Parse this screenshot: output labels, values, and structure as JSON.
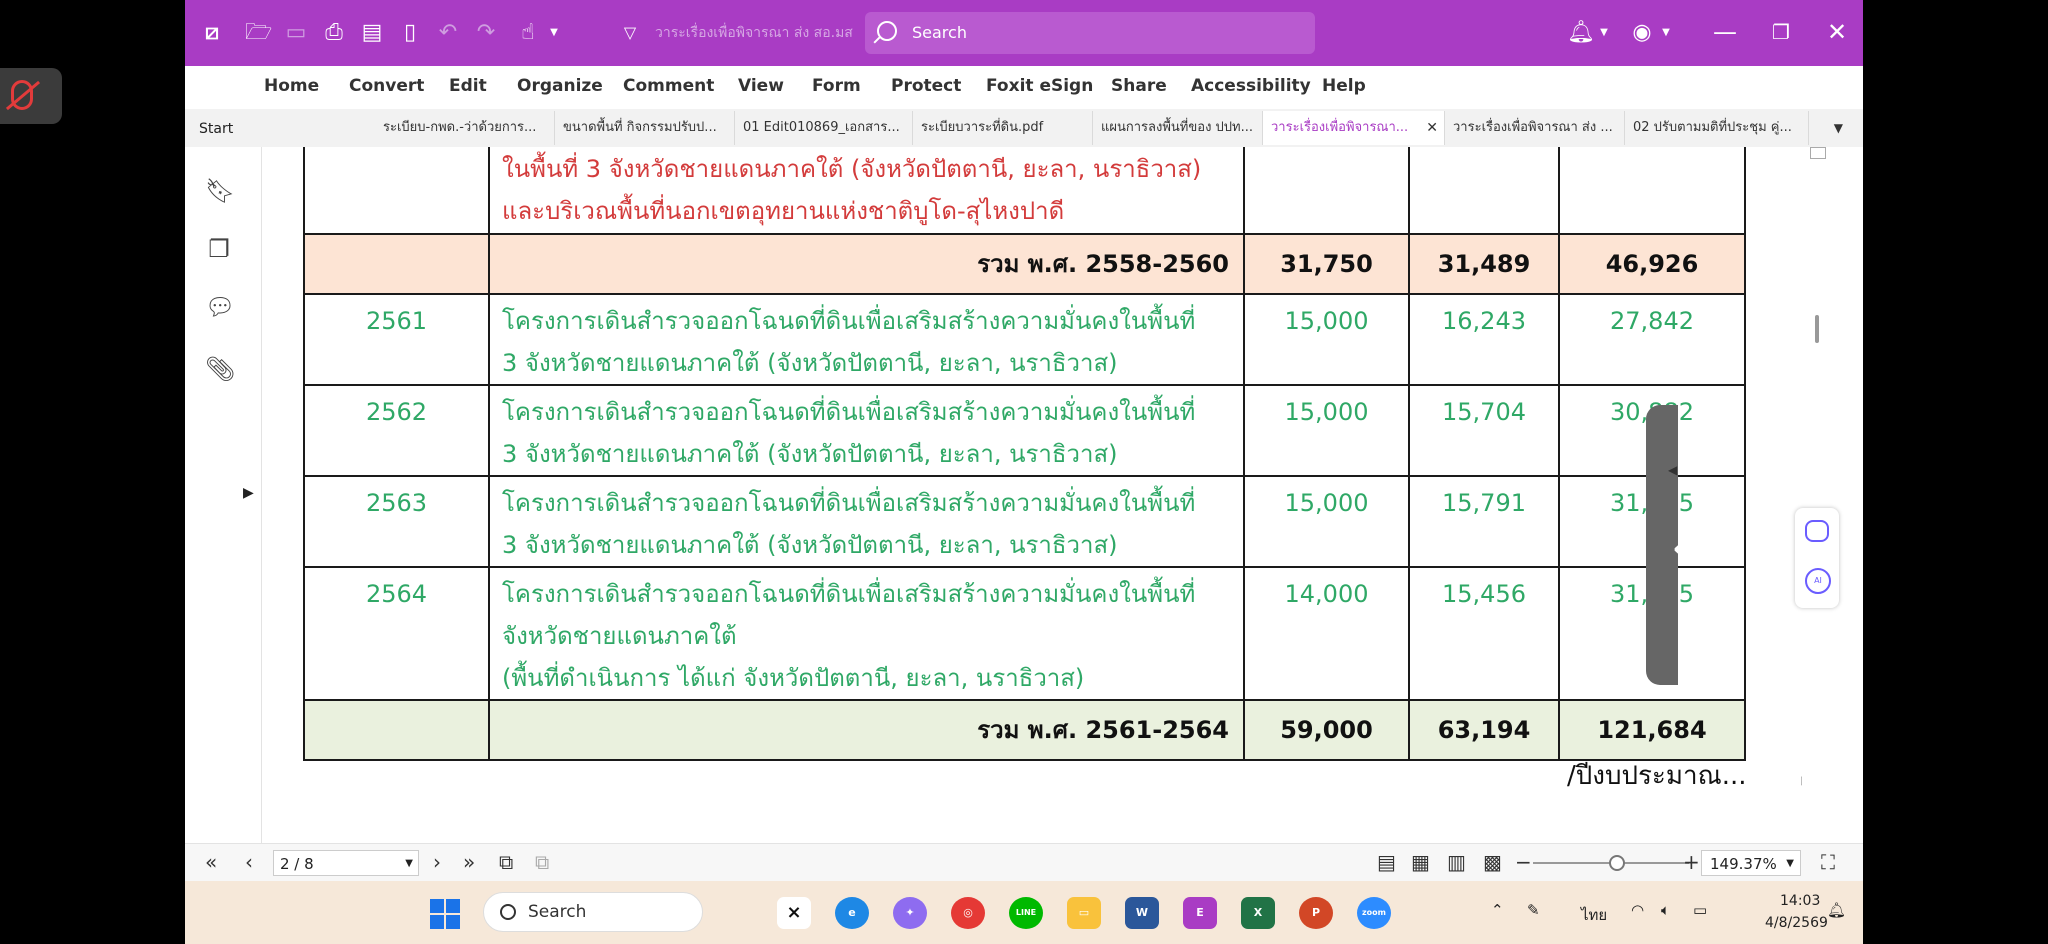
{
  "titlebar": {
    "doc_title": "วาระเรื่องเพื่อพิจารณา ส่ง สอ.มส",
    "search_placeholder": "Search"
  },
  "menu": [
    "Home",
    "Convert",
    "Edit",
    "Organize",
    "Comment",
    "View",
    "Form",
    "Protect",
    "Foxit eSign",
    "Share",
    "Accessibility",
    "Help"
  ],
  "tabs": {
    "start": "Start",
    "items": [
      "ระเบียบ-กพด.-ว่าด้วยการ...",
      "ขนาดพื้นที่ กิจกรรมปรับป...",
      "01 Edit010869_เอกสาร...",
      "ระเบียบวาระที่ดิน.pdf",
      "แผนการลงพื้นที่ของ ปปท...",
      "วาระเรื่องเพื่อพิจารณา...",
      "วาระเรื่องเพื่อพิจารณา ส่ง ...",
      "02 ปรับตามมติที่ประชุม คู่..."
    ],
    "close_glyph": "✕"
  },
  "table": {
    "top_row": {
      "line1": "ในพื้นที่ 3 จังหวัดชายแดนภาคใต้ (จังหวัดปัตตานี, ยะลา, นราธิวาส)",
      "line2": "และบริเวณพื้นที่นอกเขตอุทยานแห่งชาติบูโด-สุไหงปาดี"
    },
    "sum1": {
      "label": "รวม พ.ศ. 2558-2560",
      "v1": "31,750",
      "v2": "31,489",
      "v3": "46,926"
    },
    "rows": [
      {
        "year": "2561",
        "line1": "โครงการเดินสำรวจออกโฉนดที่ดินเพื่อเสริมสร้างความมั่นคงในพื้นที่",
        "line2": "3 จังหวัดชายแดนภาคใต้ (จังหวัดปัตตานี, ยะลา, นราธิวาส)",
        "line3": "",
        "v1": "15,000",
        "v2": "16,243",
        "v3": "27,842"
      },
      {
        "year": "2562",
        "line1": "โครงการเดินสำรวจออกโฉนดที่ดินเพื่อเสริมสร้างความมั่นคงในพื้นที่",
        "line2": "3 จังหวัดชายแดนภาคใต้ (จังหวัดปัตตานี, ยะลา, นราธิวาส)",
        "line3": "",
        "v1": "15,000",
        "v2": "15,704",
        "v3": "30,882"
      },
      {
        "year": "2563",
        "line1": "โครงการเดินสำรวจออกโฉนดที่ดินเพื่อเสริมสร้างความมั่นคงในพื้นที่",
        "line2": "3 จังหวัดชายแดนภาคใต้ (จังหวัดปัตตานี, ยะลา, นราธิวาส)",
        "line3": "",
        "v1": "15,000",
        "v2": "15,791",
        "v3": "31,575"
      },
      {
        "year": "2564",
        "line1": "โครงการเดินสำรวจออกโฉนดที่ดินเพื่อเสริมสร้างความมั่นคงในพื้นที่",
        "line2": "จังหวัดชายแดนภาคใต้",
        "line3": "(พื้นที่ดำเนินการ ได้แก่ จังหวัดปัตตานี, ยะลา, นราธิวาส)",
        "v1": "14,000",
        "v2": "15,456",
        "v3": "31,385"
      }
    ],
    "sum2": {
      "label": "รวม พ.ศ. 2561-2564",
      "v1": "59,000",
      "v2": "63,194",
      "v3": "121,684"
    }
  },
  "footnote": "/ปีงบประมาณ...",
  "navbar": {
    "page": "2 / 8",
    "zoom": "149.37%"
  },
  "taskbar": {
    "search": "Search",
    "lang": "ไทย",
    "time": "14:03",
    "date": "4/8/2569"
  },
  "colors": {
    "titlebar": "#a93cc4",
    "red_text": "#d33b3b",
    "green_text": "#2fa866",
    "sum1_bg": "#fde4d4",
    "sum2_bg": "#eaf1de"
  }
}
